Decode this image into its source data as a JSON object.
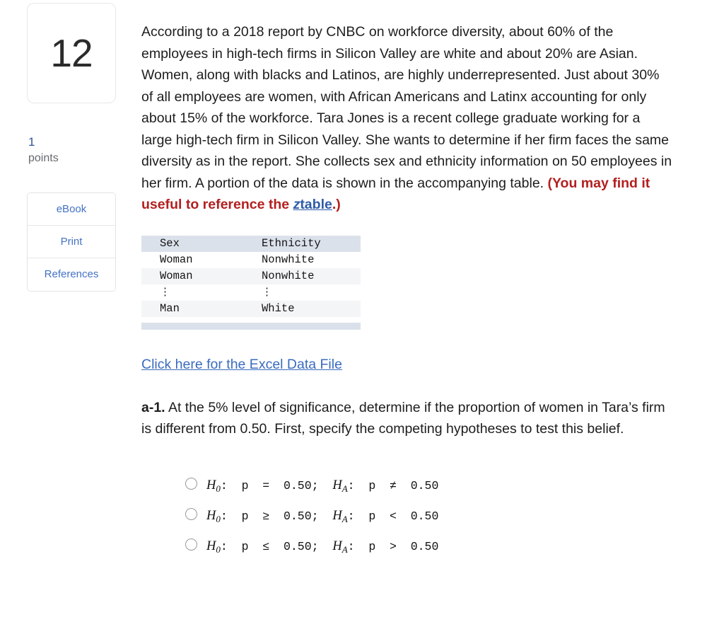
{
  "question": {
    "number": "12",
    "points_value": "1",
    "points_label": "points"
  },
  "rail_buttons": [
    {
      "label": "eBook",
      "name": "ebook-button"
    },
    {
      "label": "Print",
      "name": "print-button"
    },
    {
      "label": "References",
      "name": "references-button"
    }
  ],
  "stem": {
    "body": "According to a 2018 report by CNBC on workforce diversity, about 60% of the employees in high-tech firms in Silicon Valley are white and about 20% are Asian. Women, along with blacks and Latinos, are highly underrepresented. Just about 30% of all employees are women, with African Americans and Latinx accounting for only about 15% of the workforce. Tara Jones is a recent college graduate working for a large high-tech firm in Silicon Valley. She wants to determine if her firm faces the same diversity as in the report. She collects sex and ethnicity information on 50 employees in her firm. A portion of the data is shown in the accompanying table. ",
    "note_open": "(You may find it useful to reference the ",
    "link_z": "z",
    "link_table": "table",
    "note_close": ".)"
  },
  "data_table": {
    "headers": [
      "Sex",
      "Ethnicity"
    ],
    "rows": [
      [
        "Woman",
        "Nonwhite"
      ],
      [
        "Woman",
        "Nonwhite"
      ],
      [
        "⋮",
        "⋮"
      ],
      [
        "Man",
        "White"
      ]
    ]
  },
  "excel_link": {
    "label": "Click here for the Excel Data File"
  },
  "subquestion": {
    "label": "a-1.",
    "text": " At the 5% level of significance, determine if the proportion of women in Tara’s firm is different from 0.50. First, specify the competing hypotheses to test this belief."
  },
  "options": [
    {
      "id": "option-a",
      "h0_var": "H",
      "h0_sub": "0",
      "h0_rest": ":  p  =  0.50;  ",
      "ha_var": "H",
      "ha_sub": "A",
      "ha_rest": ":  p  ≠  0.50",
      "plain": "H0: p = 0.50; HA: p ≠ 0.50",
      "selected": false
    },
    {
      "id": "option-b",
      "h0_var": "H",
      "h0_sub": "0",
      "h0_rest": ":  p  ≥  0.50;  ",
      "ha_var": "H",
      "ha_sub": "A",
      "ha_rest": ":  p  <  0.50",
      "plain": "H0: p ≥ 0.50; HA: p < 0.50",
      "selected": false
    },
    {
      "id": "option-c",
      "h0_var": "H",
      "h0_sub": "0",
      "h0_rest": ":  p  ≤  0.50;  ",
      "ha_var": "H",
      "ha_sub": "A",
      "ha_rest": ":  p  >  0.50",
      "plain": "H0: p ≤ 0.50; HA: p > 0.50",
      "selected": false
    }
  ],
  "colors": {
    "link_blue": "#3a6bbf",
    "rail_blue": "#4472c4",
    "note_red": "#b32020",
    "table_header_bg": "#dbe1ea",
    "table_stripe_bg": "#f4f5f6",
    "points_blue": "#2f5496"
  }
}
